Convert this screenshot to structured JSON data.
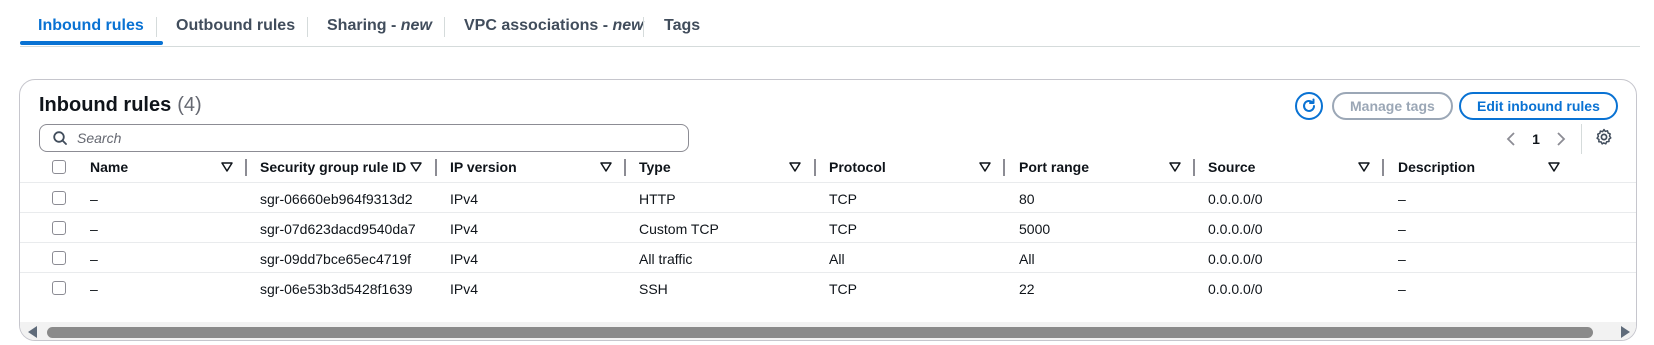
{
  "tabs": [
    {
      "label": "Inbound rules",
      "suffix": ""
    },
    {
      "label": "Outbound rules",
      "suffix": ""
    },
    {
      "label": "Sharing - ",
      "suffix": "new"
    },
    {
      "label": "VPC associations - ",
      "suffix": "new"
    },
    {
      "label": "Tags",
      "suffix": ""
    }
  ],
  "panel": {
    "title": "Inbound rules",
    "count": "(4)",
    "refresh_icon": "refresh-icon",
    "manage_tags_label": "Manage tags",
    "edit_rules_label": "Edit inbound rules",
    "search_placeholder": "Search",
    "page_number": "1"
  },
  "table": {
    "columns": [
      "Name",
      "Security group rule ID",
      "IP version",
      "Type",
      "Protocol",
      "Port range",
      "Source",
      "Description"
    ],
    "rows": [
      [
        "–",
        "sgr-06660eb964f9313d2",
        "IPv4",
        "HTTP",
        "TCP",
        "80",
        "0.0.0.0/0",
        "–"
      ],
      [
        "–",
        "sgr-07d623dacd9540da7",
        "IPv4",
        "Custom TCP",
        "TCP",
        "5000",
        "0.0.0.0/0",
        "–"
      ],
      [
        "–",
        "sgr-09dd7bce65ec4719f",
        "IPv4",
        "All traffic",
        "All",
        "All",
        "0.0.0.0/0",
        "–"
      ],
      [
        "–",
        "sgr-06e53b3d5428f1639",
        "IPv4",
        "SSH",
        "TCP",
        "22",
        "0.0.0.0/0",
        "–"
      ]
    ]
  },
  "colors": {
    "accent": "#0972d3",
    "disabled": "#9ba7b6"
  }
}
